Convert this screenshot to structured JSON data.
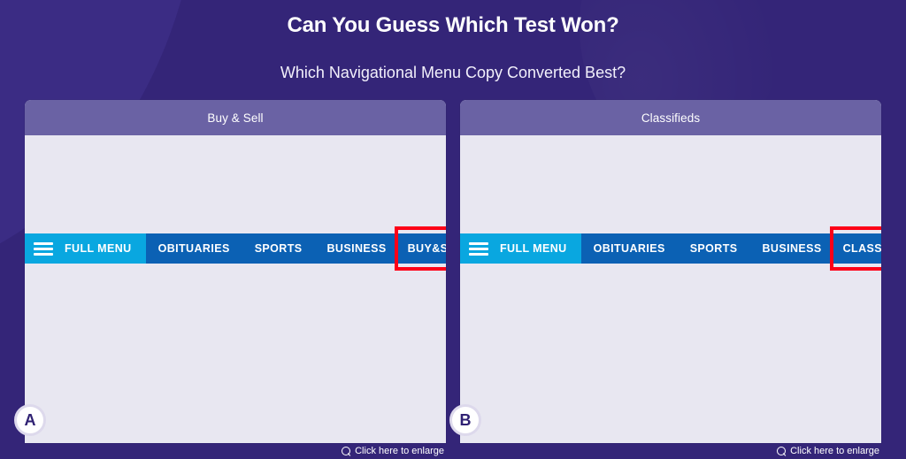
{
  "theme": {
    "background": "#342578",
    "card_header": "#6a62a4",
    "card_body": "#e8e7f1",
    "nav_primary": "#0b61b4",
    "nav_accent": "#09a7e0",
    "highlight_box": "#fd0017",
    "badge_text": "#2f2173"
  },
  "header": {
    "title": "Can You Guess Which Test Won?",
    "subtitle": "Which Navigational Menu Copy Converted Best?"
  },
  "variants": [
    {
      "badge": "A",
      "header_label": "Buy & Sell",
      "enlarge_label": "Click here to enlarge",
      "enlarge_icon": "search-icon",
      "nav": {
        "menu_icon": "hamburger-icon",
        "menu_label": "FULL MENU",
        "links": [
          "OBITUARIES",
          "SPORTS",
          "BUSINESS"
        ],
        "highlighted_link": "BUY&SELL"
      }
    },
    {
      "badge": "B",
      "header_label": "Classifieds",
      "enlarge_label": "Click here to enlarge",
      "enlarge_icon": "search-icon",
      "nav": {
        "menu_icon": "hamburger-icon",
        "menu_label": "FULL MENU",
        "links": [
          "OBITUARIES",
          "SPORTS",
          "BUSINESS"
        ],
        "highlighted_link": "CLASSIFIEDS"
      }
    }
  ]
}
